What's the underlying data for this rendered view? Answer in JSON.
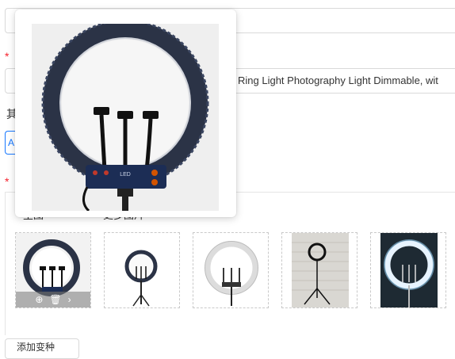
{
  "form": {
    "required_mark": "*",
    "title_value": "Ring Light Photography Light Dimmable, wit",
    "other_label_fragment": "其",
    "blue_button_glyph": "A",
    "upload_required_mark": "*"
  },
  "upload": {
    "tabs": [
      {
        "label": "主图"
      },
      {
        "label": "更多图片"
      }
    ],
    "thumbnails": [
      {
        "name": "ring-light-thumb-1",
        "style": "dark ring with three phone holders, toolbar visible"
      },
      {
        "name": "ring-light-thumb-2",
        "style": "small dark ring on tripod"
      },
      {
        "name": "ring-light-thumb-3",
        "style": "white lit ring"
      },
      {
        "name": "ring-light-thumb-4",
        "style": "ring on tripod against brick wall"
      },
      {
        "name": "ring-light-thumb-5",
        "style": "glowing ring on dark background"
      }
    ],
    "toolbar_icons": [
      "zoom-icon",
      "delete-icon",
      "next-icon"
    ],
    "toolbar_glyphs": {
      "zoom": "⊕",
      "delete": "🗑",
      "next": "›"
    }
  },
  "preview": {
    "panel_label": "LED",
    "image_subject": "ring light with three phone holders"
  },
  "bottom_button": {
    "label": "添加变种"
  },
  "colors": {
    "required": "#f5222d",
    "accent": "#1677ff",
    "border": "#d9d9d9",
    "ring_dark": "#2b3346"
  }
}
